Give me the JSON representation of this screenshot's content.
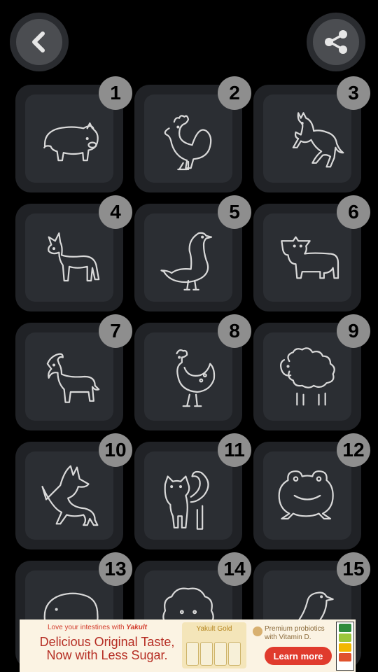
{
  "toolbar": {
    "back_icon": "chevron-left-icon",
    "share_icon": "share-icon"
  },
  "animals": [
    {
      "number": "1",
      "icon": "pig-icon"
    },
    {
      "number": "2",
      "icon": "rooster-icon"
    },
    {
      "number": "3",
      "icon": "horse-icon"
    },
    {
      "number": "4",
      "icon": "donkey-icon"
    },
    {
      "number": "5",
      "icon": "goose-icon"
    },
    {
      "number": "6",
      "icon": "cow-icon"
    },
    {
      "number": "7",
      "icon": "goat-icon"
    },
    {
      "number": "8",
      "icon": "hen-icon"
    },
    {
      "number": "9",
      "icon": "sheep-icon"
    },
    {
      "number": "10",
      "icon": "dog-icon"
    },
    {
      "number": "11",
      "icon": "cat-icon"
    },
    {
      "number": "12",
      "icon": "frog-icon"
    },
    {
      "number": "13",
      "icon": "elephant-icon"
    },
    {
      "number": "14",
      "icon": "lion-icon"
    },
    {
      "number": "15",
      "icon": "bird-icon"
    }
  ],
  "ad": {
    "tag_prefix": "Love your intestines with",
    "tag_brand": "Yakult",
    "headline_1": "Delicious Original Taste,",
    "headline_2": "Now with Less Sugar.",
    "product_label": "Yakult Gold",
    "probiotic_text": "Premium probiotics with Vitamin D.",
    "cta": "Learn more",
    "cta_color": "#e03b2d"
  }
}
